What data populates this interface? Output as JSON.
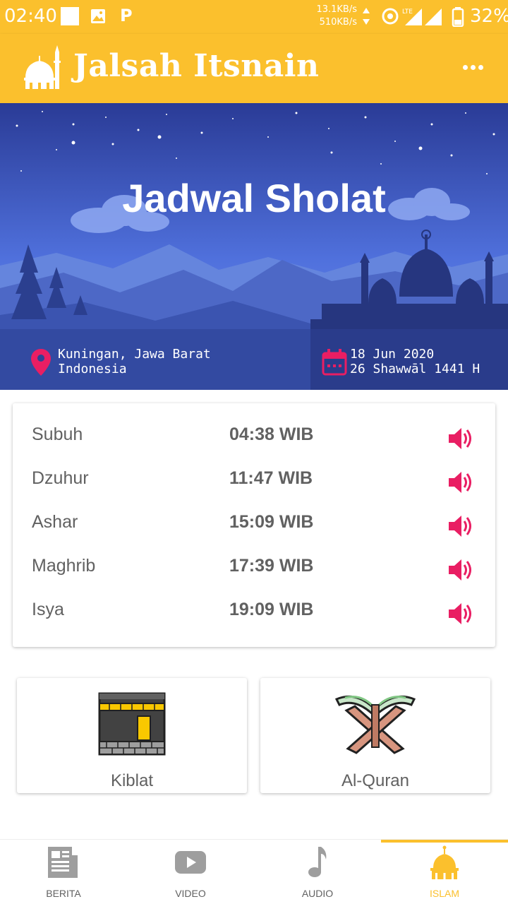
{
  "status_bar": {
    "time": "02:40",
    "speed_up": "13.1KB/s",
    "speed_down": "510KB/s",
    "network": "LTE",
    "battery": "32%",
    "p_label": "P"
  },
  "app_bar": {
    "title": "Jalsah Itsnain"
  },
  "hero": {
    "title": "Jadwal Sholat",
    "location_line1": "Kuningan, Jawa Barat",
    "location_line2": "Indonesia",
    "date_gregorian": "18 Jun 2020",
    "date_hijri": "26 Shawwāl 1441 H"
  },
  "prayers": [
    {
      "name": "Subuh",
      "time": "04:38 WIB"
    },
    {
      "name": "Dzuhur",
      "time": "11:47 WIB"
    },
    {
      "name": "Ashar",
      "time": "15:09 WIB"
    },
    {
      "name": "Maghrib",
      "time": "17:39 WIB"
    },
    {
      "name": "Isya",
      "time": "19:09 WIB"
    }
  ],
  "features": {
    "kiblat_label": "Kiblat",
    "quran_label": "Al-Quran"
  },
  "bottom_nav": {
    "items": [
      {
        "label": "BERITA",
        "icon": "newspaper-icon"
      },
      {
        "label": "VIDEO",
        "icon": "youtube-icon"
      },
      {
        "label": "AUDIO",
        "icon": "music-note-icon"
      },
      {
        "label": "ISLAM",
        "icon": "mosque-icon"
      }
    ],
    "active": "ISLAM"
  },
  "colors": {
    "primary": "#fbc02d",
    "accent": "#e91e63",
    "text": "#616161"
  }
}
